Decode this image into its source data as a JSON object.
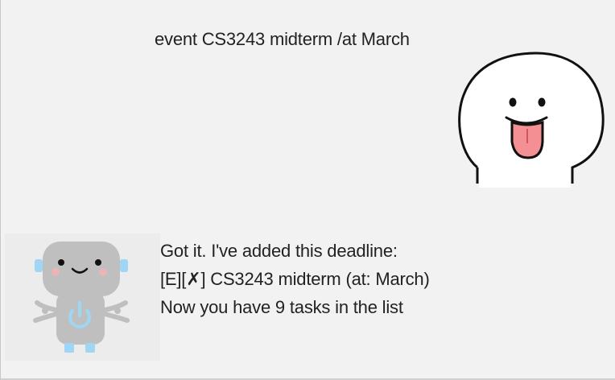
{
  "user_message": {
    "text": "event CS3243 midterm /at March",
    "avatar_icon": "tongue-out-face-icon"
  },
  "bot_message": {
    "lines": [
      "Got it. I've added this deadline:",
      "[E][✗] CS3243 midterm (at: March)",
      "Now you have 9 tasks in the list"
    ],
    "avatar_icon": "robot-icon"
  },
  "colors": {
    "background": "#f2f2f2",
    "text": "#222222",
    "robot_body": "#bfbfbf",
    "robot_accent": "#9fd6f3",
    "tongue": "#f48f93"
  }
}
